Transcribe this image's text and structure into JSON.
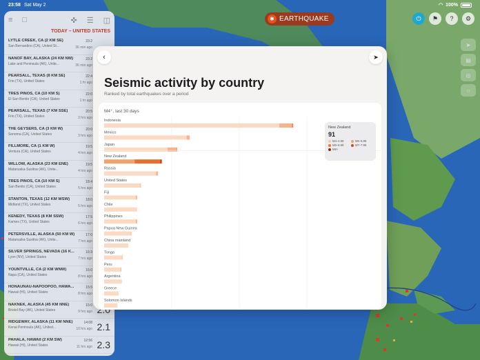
{
  "status": {
    "time": "23:58",
    "date": "Sat May 2",
    "battery": "100%"
  },
  "app": {
    "badge_label": "EARTHQUAKE"
  },
  "sidebar": {
    "header": "TODAY – UNITED STATES",
    "items": [
      {
        "title": "LYTLE CREEK, CA (2 KM SE)",
        "sub": "San Bernardino (CA), United St...",
        "time": "23:2",
        "ago": "36 min ago",
        "mag": ""
      },
      {
        "title": "NANOF BAY, ALASKA (24 KM NW)",
        "sub": "Lake and Peninsula (AK), Unite...",
        "time": "23:2",
        "ago": "36 min ago",
        "mag": ""
      },
      {
        "title": "PEARSALL, TEXAS (8 KM SE)",
        "sub": "Frio (TX), United States",
        "time": "22:4",
        "ago": "1 hr ago",
        "mag": ""
      },
      {
        "title": "TRES PINOS, CA (10 KM S)",
        "sub": "El San Benito (CA), United States",
        "time": "22:0",
        "ago": "1 hr ago",
        "mag": ""
      },
      {
        "title": "PEARSALL, TEXAS (7 KM SSE)",
        "sub": "Frio (TX), United States",
        "time": "20:5",
        "ago": "3 hrs ago",
        "mag": ""
      },
      {
        "title": "THE GEYSERS, CA (3 KM W)",
        "sub": "Sonoma (CA), United States",
        "time": "20:0",
        "ago": "3 hrs ago",
        "mag": ""
      },
      {
        "title": "FILLMORE, CA (1 KM W)",
        "sub": "Ventura (CA), United States",
        "time": "19:5",
        "ago": "4 hrs ago",
        "mag": ""
      },
      {
        "title": "WILLOW, ALASKA (23 KM ENE)",
        "sub": "Matanuska-Susitna (AK), Unite...",
        "time": "19:5",
        "ago": "4 hrs ago",
        "mag": ""
      },
      {
        "title": "TRES PINOS, CA (10 KM S)",
        "sub": "San Benito (CA), United States",
        "time": "18:4",
        "ago": "5 hrs ago",
        "mag": ""
      },
      {
        "title": "STANTON, TEXAS (12 KM WSW)",
        "sub": "Midland (TX), United States",
        "time": "18:0",
        "ago": "5 hrs ago",
        "mag": ""
      },
      {
        "title": "KENEDY, TEXAS (8 KM SSW)",
        "sub": "Karnes (TX), United States",
        "time": "17:5",
        "ago": "6 hrs ago",
        "mag": ""
      },
      {
        "title": "PETERSVILLE, ALASKA (50 KM W)",
        "sub": "Matanuska-Susitna (AK), Unite...",
        "time": "17:0",
        "ago": "7 hrs ago",
        "mag": ""
      },
      {
        "title": "SILVER SPRINGS, NEVADA (16 K...",
        "sub": "Lyon (NV), United States",
        "time": "16:3",
        "ago": "7 hrs ago",
        "mag": ""
      },
      {
        "title": "YOUNTVILLE, CA (2 KM WNW)",
        "sub": "Napa (CA), United States",
        "time": "16:0",
        "ago": "8 hrs ago",
        "mag": ""
      },
      {
        "title": "HONAUNAU-NAPOOPOO, HAWA...",
        "sub": "Hawaii (HI), United States",
        "time": "15:5",
        "ago": "8 hrs ago",
        "mag": ""
      },
      {
        "title": "NAKNEK, ALASKA (45 KM NNE)",
        "sub": "Bristol Bay (AK), United States",
        "time": "15:0",
        "ago": "9 hrs ago",
        "mag": "2.0"
      },
      {
        "title": "RIDGEWAY, ALASKA (11 KM NNE)",
        "sub": "Kenai Peninsula (AK), United...",
        "time": "14:08",
        "ago": "10 hrs ago",
        "mag": "2.1"
      },
      {
        "title": "PAHALA, HAWAII (2 KM SW)",
        "sub": "Hawaii (HI), United States",
        "time": "12:56",
        "ago": "11 hrs ago",
        "mag": "2.3"
      }
    ]
  },
  "modal": {
    "title": "Seismic activity by country",
    "subtitle": "Ranked by total earthquakes over a period",
    "filter": "M4⁺, last 30 days",
    "tooltip": {
      "country": "New Zealand",
      "total": "91",
      "legend": [
        {
          "label": "M4–4.99",
          "color": "#f6c7a8"
        },
        {
          "label": "M5–5.99",
          "color": "#f0a06c"
        },
        {
          "label": "M6–6.99",
          "color": "#e8763c"
        },
        {
          "label": "M7–7.99",
          "color": "#c94b1f"
        },
        {
          "label": "M8+",
          "color": "#8d2a10"
        }
      ]
    }
  },
  "chart_data": {
    "type": "bar",
    "orientation": "horizontal",
    "stacked": true,
    "title": "Seismic activity by country",
    "subtitle": "Ranked by total earthquakes over a period",
    "filter": "M4⁺, last 30 days",
    "highlighted": "New Zealand",
    "categories": [
      "Indonesia",
      "Mexico",
      "Japan",
      "New Zealand",
      "Russia",
      "United States",
      "Fiji",
      "Chile",
      "Philippines",
      "Papua New Guinea",
      "China mainland",
      "Tonga",
      "Peru",
      "Argentina",
      "Greece",
      "Solomon Islands"
    ],
    "series": [
      {
        "name": "M4–4.99",
        "values": [
          276,
          130,
          100,
          48,
          82,
          57,
          50,
          52,
          50,
          42,
          38,
          28,
          26,
          28,
          23,
          21
        ]
      },
      {
        "name": "M5–5.99",
        "values": [
          20,
          5,
          14,
          40,
          3,
          1,
          2,
          0,
          2,
          1,
          0,
          1,
          1,
          0,
          0,
          0
        ]
      },
      {
        "name": "M6–6.99",
        "values": [
          2,
          0,
          1,
          3,
          0,
          0,
          0,
          0,
          0,
          0,
          0,
          0,
          0,
          0,
          0,
          0
        ]
      }
    ]
  },
  "colors": {
    "bar_light": "#f8cdb0",
    "bar_mid": "#f2ad83",
    "bar_dark": "#e07a44",
    "highlight_dark": "#d45a22",
    "accent": "#c0392b"
  }
}
